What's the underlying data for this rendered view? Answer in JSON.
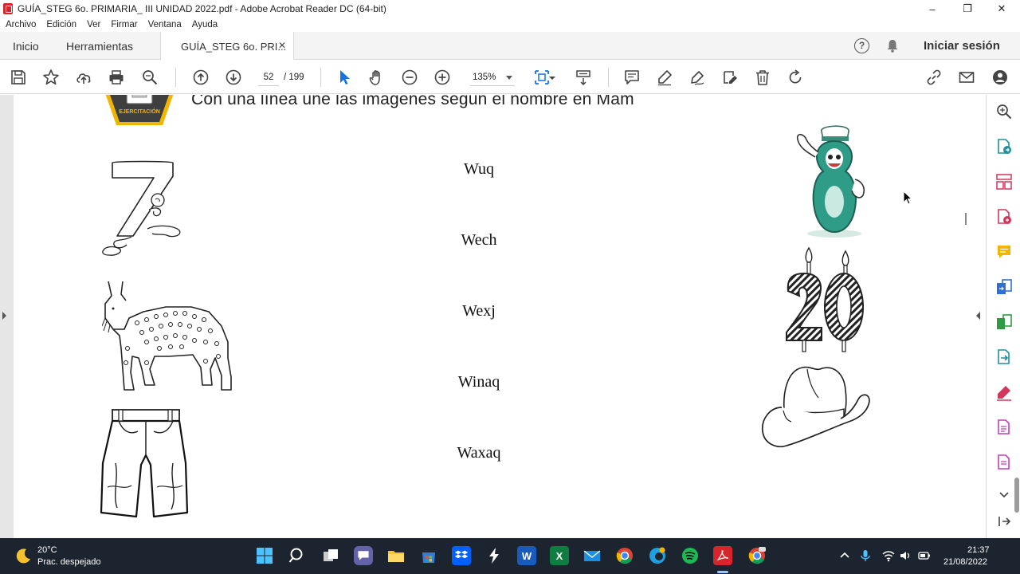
{
  "window": {
    "title": "GUÍA_STEG 6o. PRIMARIA_ III UNIDAD 2022.pdf - Adobe Acrobat Reader DC (64-bit)",
    "minimize": "–",
    "maximize": "❐",
    "close": "✕"
  },
  "menu": [
    "Archivo",
    "Edición",
    "Ver",
    "Firmar",
    "Ventana",
    "Ayuda"
  ],
  "tabs": {
    "home": "Inicio",
    "tools": "Herramientas",
    "document": "GUÍA_STEG 6o. PRI...",
    "close": "✕",
    "help": "?",
    "signin": "Iniciar sesión"
  },
  "toolbar": {
    "current_page": "52",
    "page_total": "/ 199",
    "zoom": "135%"
  },
  "document": {
    "instruction": "Con una línea une las imágenes según el nombre en Mam",
    "badge_label": "EJERCITACIÓN",
    "words": [
      "Wuq",
      "Wech",
      "Wexj",
      "Winaq",
      "Waxaq"
    ],
    "left_images": [
      "number-seven-drawing",
      "lynx-drawing",
      "trousers-drawing"
    ],
    "right_images": [
      "number-eight-mascot",
      "number-twenty-candles",
      "cowboy-hat-drawing"
    ],
    "accent_color": "#f2b600",
    "eight_color": "#2e9c86"
  },
  "taskbar": {
    "temperature": "20°C",
    "weather": "Prac. despejado",
    "time": "21:37",
    "date": "21/08/2022"
  }
}
